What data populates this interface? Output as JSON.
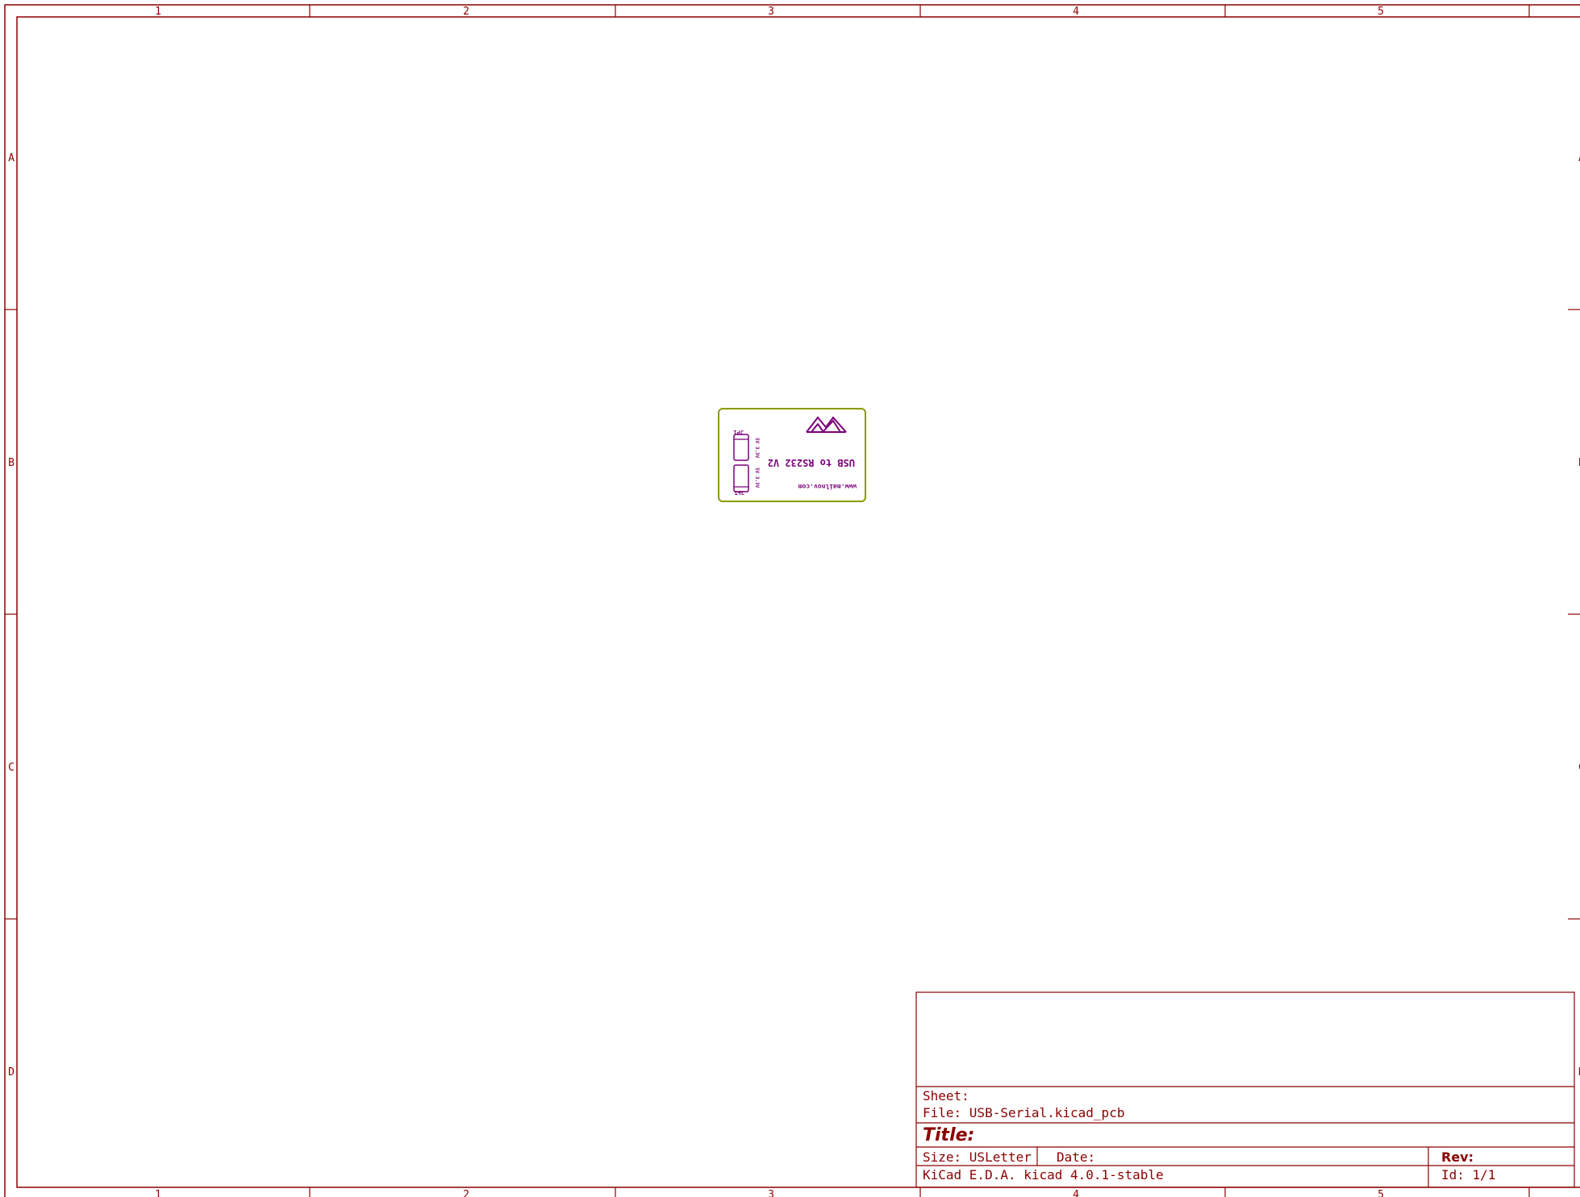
{
  "frame": {
    "columns": [
      "1",
      "2",
      "3",
      "4",
      "5"
    ],
    "rows": [
      "A",
      "B",
      "C",
      "D"
    ],
    "colors": {
      "border": "#8b0000",
      "silk": "#7a007a",
      "edge": "#8a9a00"
    }
  },
  "title_block": {
    "sheet_label": "Sheet:",
    "file_label": "File: USB-Serial.kicad_pcb",
    "title_label": "Title:",
    "size_label": "Size: USLetter",
    "date_label": "Date:",
    "rev_label": "Rev:",
    "kicad_label": "KiCad E.D.A.  kicad 4.0.1-stable",
    "id_label": "Id: 1/1"
  },
  "board": {
    "title_text": "USB to RS232 V2",
    "url_text": "www.mailnov.com",
    "jp1_label": "JP1",
    "jp2_label": "JP2",
    "jp1_side_text": "5V 3.3V",
    "jp2_side_text": "5V 3.3V",
    "logo_icon": "mountain-logo-icon"
  }
}
